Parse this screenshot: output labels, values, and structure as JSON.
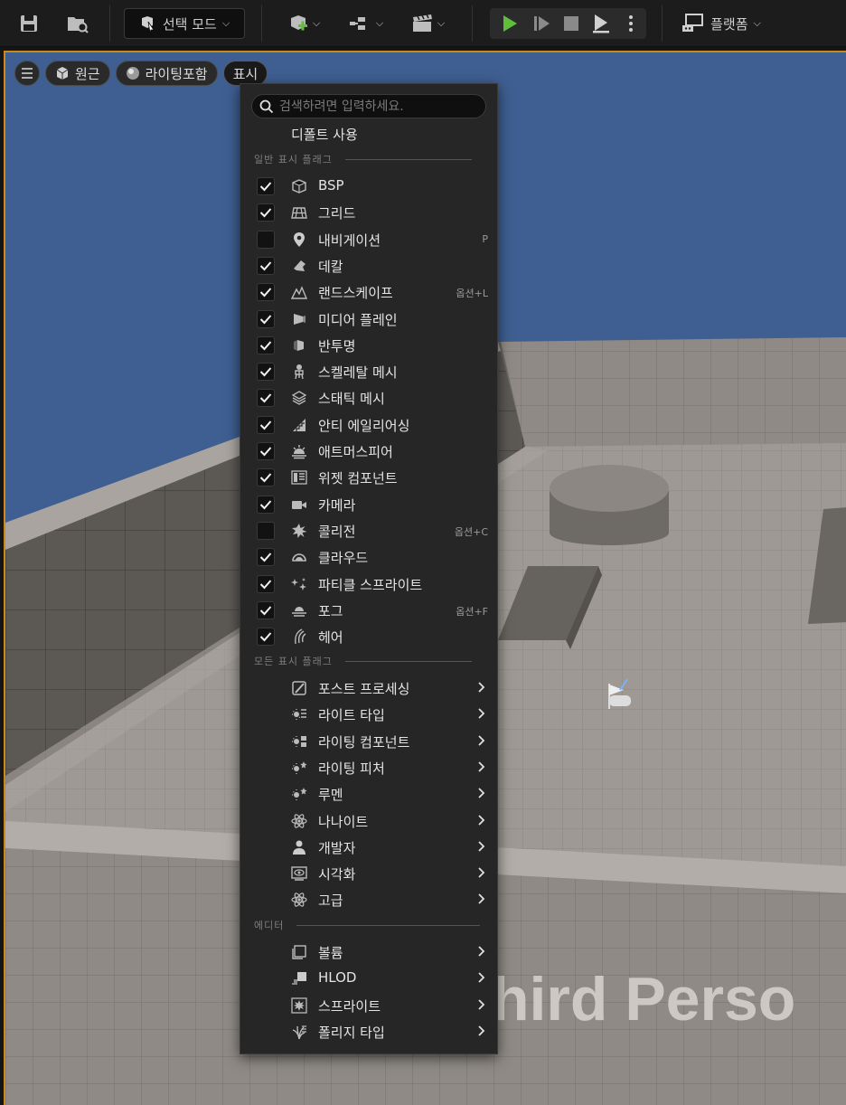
{
  "toolbar": {
    "mode_label": "선택 모드",
    "platform_label": "플랫폼"
  },
  "viewport": {
    "perspective_label": "원근",
    "lighting_label": "라이팅포함",
    "show_label": "표시",
    "world_text": "hird Perso"
  },
  "menu": {
    "search_placeholder": "검색하려면 입력하세요.",
    "default_label": "디폴트 사용",
    "sections": {
      "common": "일반 표시 플래그",
      "all": "모든 표시 플래그",
      "editor": "에디터"
    },
    "flags": [
      {
        "label": "BSP",
        "checked": true,
        "icon": "bsp-icon",
        "shortcut": ""
      },
      {
        "label": "그리드",
        "checked": true,
        "icon": "grid-icon",
        "shortcut": ""
      },
      {
        "label": "내비게이션",
        "checked": false,
        "icon": "navigation-pin-icon",
        "shortcut": "P"
      },
      {
        "label": "데칼",
        "checked": true,
        "icon": "decal-icon",
        "shortcut": ""
      },
      {
        "label": "랜드스케이프",
        "checked": true,
        "icon": "landscape-icon",
        "shortcut": "옵션+L"
      },
      {
        "label": "미디어 플레인",
        "checked": true,
        "icon": "media-plane-icon",
        "shortcut": ""
      },
      {
        "label": "반투명",
        "checked": true,
        "icon": "translucency-icon",
        "shortcut": ""
      },
      {
        "label": "스켈레탈 메시",
        "checked": true,
        "icon": "skeletal-mesh-icon",
        "shortcut": ""
      },
      {
        "label": "스태틱 메시",
        "checked": true,
        "icon": "static-mesh-icon",
        "shortcut": ""
      },
      {
        "label": "안티 에일리어싱",
        "checked": true,
        "icon": "anti-aliasing-icon",
        "shortcut": ""
      },
      {
        "label": "애트머스피어",
        "checked": true,
        "icon": "atmosphere-icon",
        "shortcut": ""
      },
      {
        "label": "위젯 컴포넌트",
        "checked": true,
        "icon": "widget-component-icon",
        "shortcut": ""
      },
      {
        "label": "카메라",
        "checked": true,
        "icon": "camera-icon",
        "shortcut": ""
      },
      {
        "label": "콜리전",
        "checked": false,
        "icon": "collision-icon",
        "shortcut": "옵션+C"
      },
      {
        "label": "클라우드",
        "checked": true,
        "icon": "cloud-icon",
        "shortcut": ""
      },
      {
        "label": "파티클 스프라이트",
        "checked": true,
        "icon": "particle-sprite-icon",
        "shortcut": ""
      },
      {
        "label": "포그",
        "checked": true,
        "icon": "fog-icon",
        "shortcut": "옵션+F"
      },
      {
        "label": "헤어",
        "checked": true,
        "icon": "hair-icon",
        "shortcut": ""
      }
    ],
    "submenus": [
      {
        "label": "포스트 프로세싱",
        "icon": "post-processing-icon"
      },
      {
        "label": "라이트 타입",
        "icon": "light-type-icon"
      },
      {
        "label": "라이팅 컴포넌트",
        "icon": "lighting-component-icon"
      },
      {
        "label": "라이팅 피처",
        "icon": "lighting-feature-icon"
      },
      {
        "label": "루멘",
        "icon": "lumen-icon"
      },
      {
        "label": "나나이트",
        "icon": "nanite-icon"
      },
      {
        "label": "개발자",
        "icon": "developer-icon"
      },
      {
        "label": "시각화",
        "icon": "visualization-icon"
      },
      {
        "label": "고급",
        "icon": "advanced-icon"
      }
    ],
    "editor_items": [
      {
        "label": "볼륨",
        "icon": "volume-icon"
      },
      {
        "label": "HLOD",
        "icon": "hlod-icon"
      },
      {
        "label": "스프라이트",
        "icon": "sprite-icon"
      },
      {
        "label": "폴리지 타입",
        "icon": "foliage-type-icon"
      }
    ]
  },
  "colors": {
    "accent_green": "#5fbf3a",
    "viewport_border": "#c98a1a",
    "sky": "#3f5f92"
  }
}
